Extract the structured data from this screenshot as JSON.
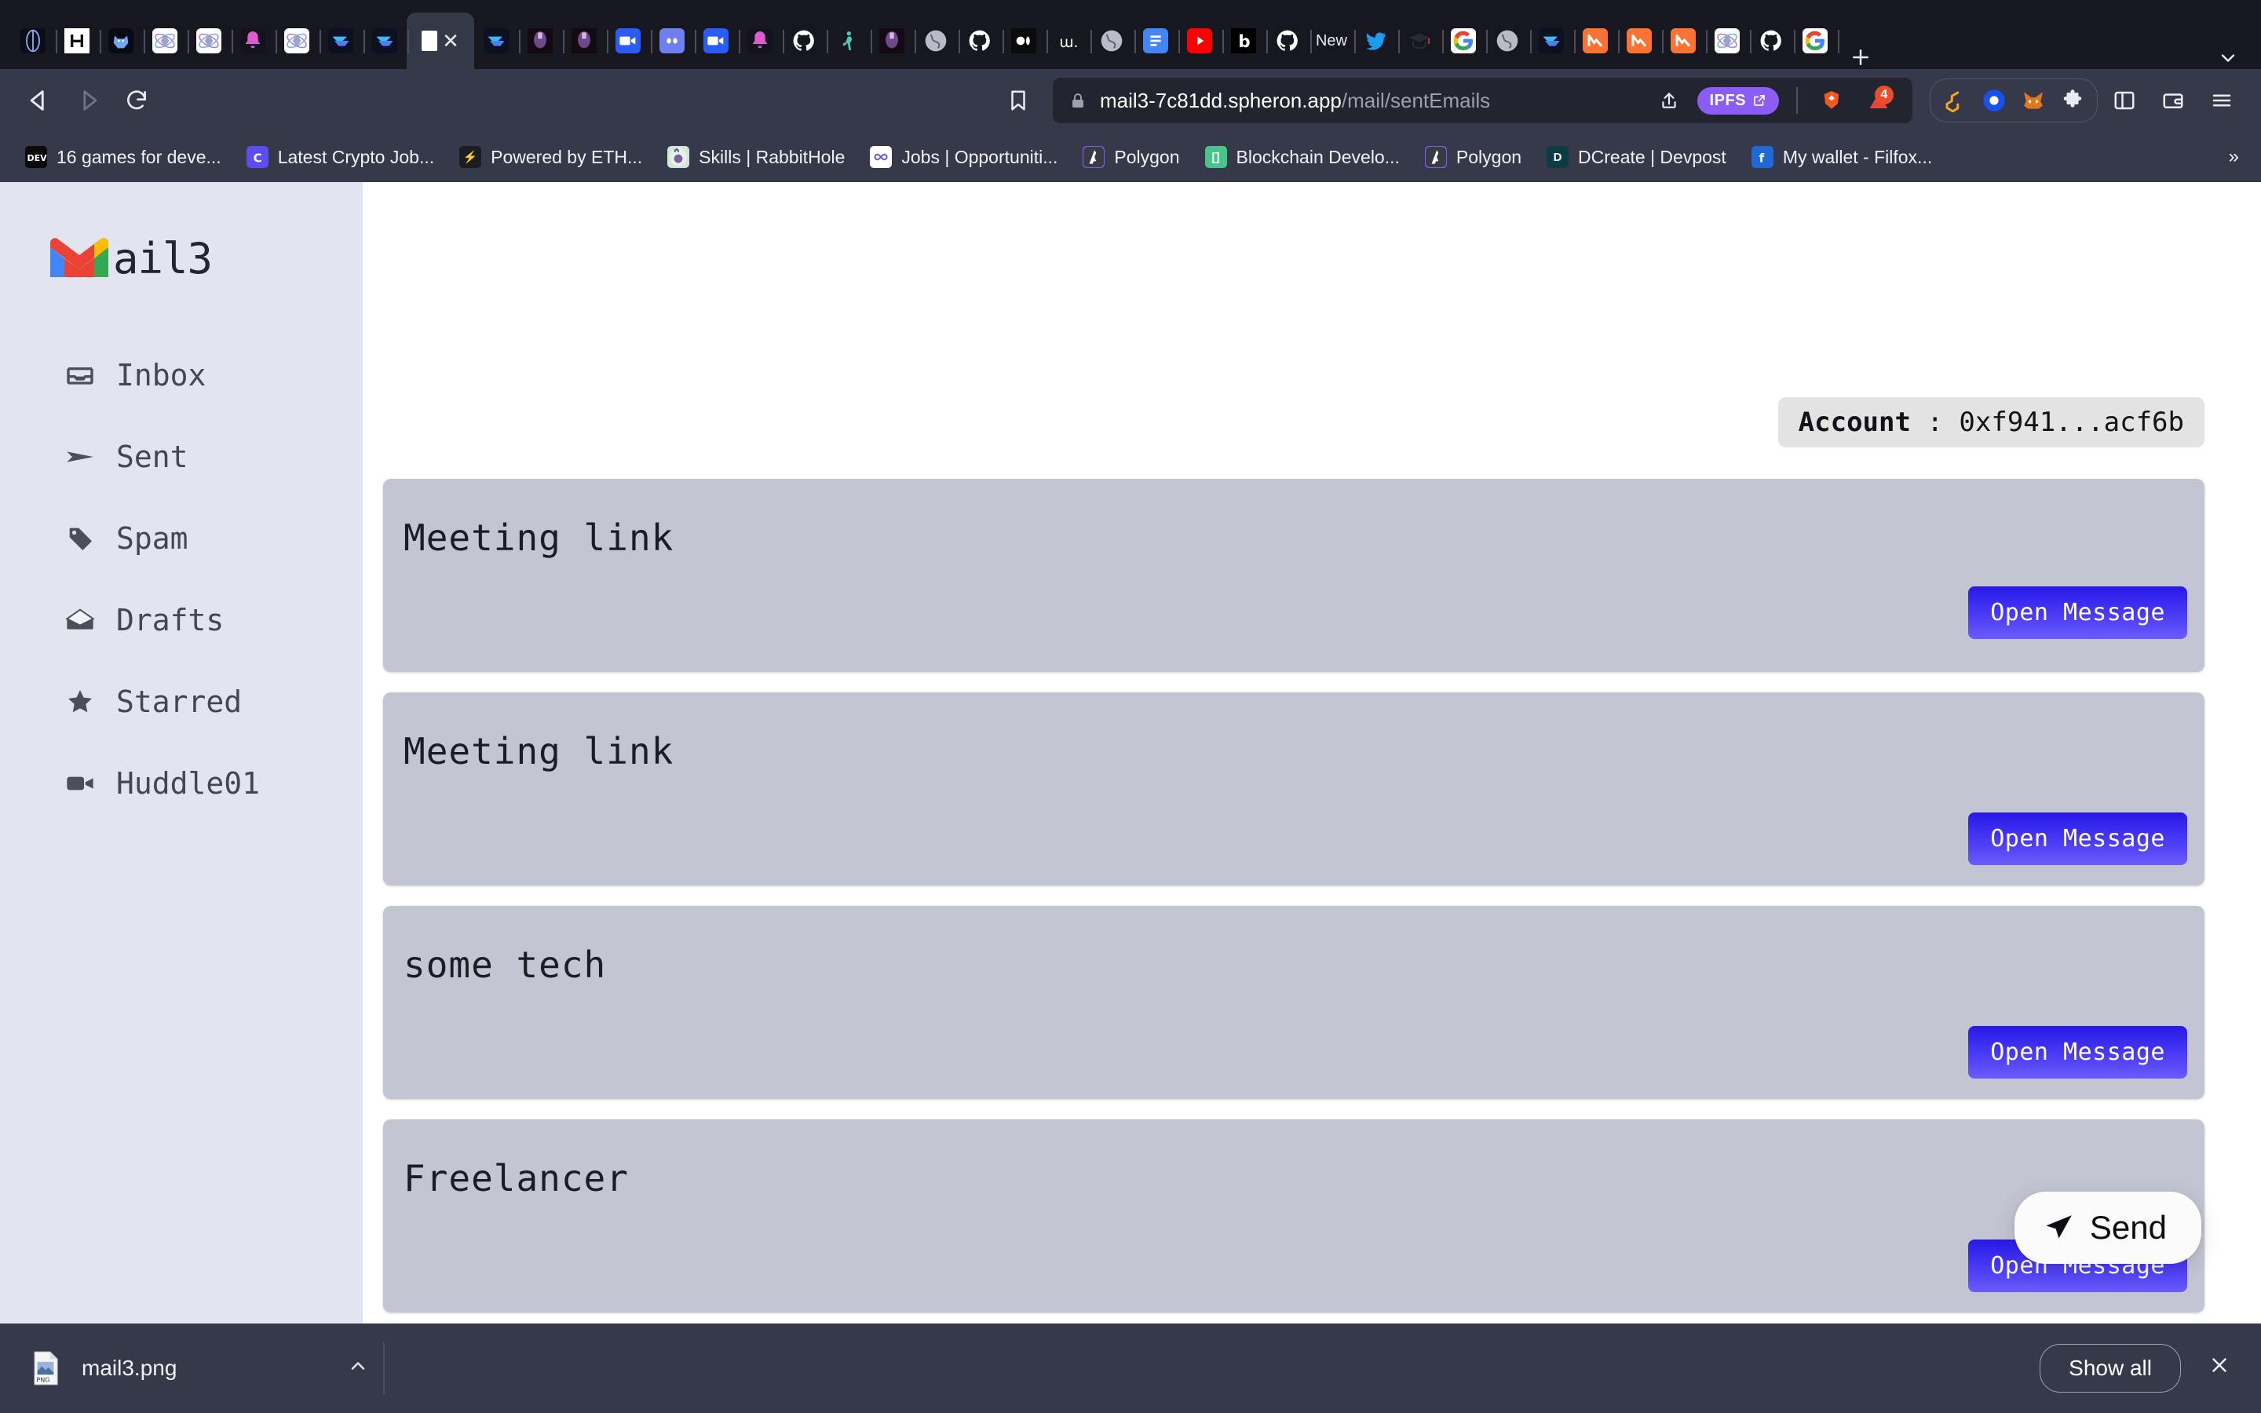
{
  "browser": {
    "tabs": [
      {
        "name": "tab-ethereum",
        "icon": "ethereum-outline-icon",
        "color": "#0b0d17"
      },
      {
        "name": "tab-indie-hackers",
        "icon": "indiehackers-icon",
        "color": "#ffffff"
      },
      {
        "name": "tab-metamask-fox",
        "icon": "fox-icon",
        "color": "#0a0a12"
      },
      {
        "name": "tab-ethereum-atom-1",
        "icon": "atom-icon",
        "color": "#ffffff"
      },
      {
        "name": "tab-ethereum-atom-2",
        "icon": "atom-icon",
        "color": "#ffffff"
      },
      {
        "name": "tab-notification-bell",
        "icon": "bell-icon",
        "color": "#12131c"
      },
      {
        "name": "tab-ethereum-atom-3",
        "icon": "atom-icon",
        "color": "#ffffff"
      },
      {
        "name": "tab-spheron-1",
        "icon": "spheron-icon",
        "color": "#0d1020"
      },
      {
        "name": "tab-spheron-2",
        "icon": "spheron-icon",
        "color": "#0d1020"
      },
      {
        "name": "tab-mail3-active",
        "icon": "mail3-icon",
        "color": "#343948",
        "active": true
      },
      {
        "name": "tab-spheron-3",
        "icon": "spheron-icon",
        "color": "#0d1020"
      },
      {
        "name": "tab-nft-avatar-1",
        "icon": "avatar-icon",
        "color": "#140a14"
      },
      {
        "name": "tab-nft-avatar-2",
        "icon": "avatar-icon",
        "color": "#140a14"
      },
      {
        "name": "tab-huddle01-1",
        "icon": "huddle01-icon",
        "color": "#2b5cf6"
      },
      {
        "name": "tab-discord",
        "icon": "discord-icon",
        "color": "#6f7ff0"
      },
      {
        "name": "tab-huddle01-2",
        "icon": "huddle01-icon",
        "color": "#2b5cf6"
      },
      {
        "name": "tab-bell-2",
        "icon": "bell-icon",
        "color": "#12131c"
      },
      {
        "name": "tab-github-1",
        "icon": "github-icon",
        "color": "#16171f"
      },
      {
        "name": "tab-runner",
        "icon": "runner-icon",
        "color": "#16171f"
      },
      {
        "name": "tab-nft-avatar-3",
        "icon": "avatar-icon",
        "color": "#140a14"
      },
      {
        "name": "tab-globe-1",
        "icon": "globe-icon",
        "color": "#16171f"
      },
      {
        "name": "tab-github-2",
        "icon": "github-icon",
        "color": "#16171f"
      },
      {
        "name": "tab-medium",
        "icon": "medium-icon",
        "color": "#0b0b0b"
      },
      {
        "name": "tab-lu-app",
        "icon": "lu-icon",
        "color": "#16171f"
      },
      {
        "name": "tab-globe-2",
        "icon": "globe-icon",
        "color": "#16171f"
      },
      {
        "name": "tab-google-docs",
        "icon": "docs-icon",
        "color": "#4285f4"
      },
      {
        "name": "tab-youtube",
        "icon": "youtube-icon",
        "color": "#ff0000"
      },
      {
        "name": "tab-b-app",
        "icon": "b-icon",
        "color": "#000000"
      },
      {
        "name": "tab-github-3",
        "icon": "github-icon",
        "color": "#16171f"
      },
      {
        "name": "tab-new",
        "icon": "new-text-icon",
        "color": "#16171f",
        "text": "New"
      },
      {
        "name": "tab-twitter",
        "icon": "twitter-icon",
        "color": "#16171f"
      },
      {
        "name": "tab-graduation",
        "icon": "graduation-cap-icon",
        "color": "#16171f"
      },
      {
        "name": "tab-google-1",
        "icon": "google-icon",
        "color": "#ffffff"
      },
      {
        "name": "tab-globe-3",
        "icon": "globe-icon",
        "color": "#16171f"
      },
      {
        "name": "tab-spheron-4",
        "icon": "spheron-icon",
        "color": "#0d1020"
      },
      {
        "name": "tab-netlify-1",
        "icon": "netlify-n-icon",
        "color": "#f97432"
      },
      {
        "name": "tab-netlify-2",
        "icon": "netlify-n-icon",
        "color": "#f97432"
      },
      {
        "name": "tab-netlify-3",
        "icon": "netlify-n-icon",
        "color": "#f97432"
      },
      {
        "name": "tab-ethereum-atom-4",
        "icon": "atom-icon",
        "color": "#ffffff"
      },
      {
        "name": "tab-github-4",
        "icon": "github-icon",
        "color": "#16171f"
      },
      {
        "name": "tab-google-2",
        "icon": "google-icon",
        "color": "#ffffff"
      }
    ],
    "new_tab_label": "+",
    "tab_list_chevron": "chevron-down-icon",
    "url": {
      "domain": "mail3-7c81dd.spheron.app",
      "path": "/mail/sentEmails",
      "lock_icon": "lock-icon"
    },
    "ipfs_badge": "IPFS",
    "shield_badge_count": "4",
    "bookmarks": [
      {
        "label": "16 games for deve...",
        "icon": "dev-icon",
        "color": "#0b0b0b",
        "glyph": "DEV"
      },
      {
        "label": "Latest Crypto Job...",
        "icon": "cryptojobs-icon",
        "color": "#5b4df0",
        "glyph": "C"
      },
      {
        "label": "Powered by ETH...",
        "icon": "lightning-icon",
        "color": "#1b1c24",
        "glyph": "⚡"
      },
      {
        "label": "Skills | RabbitHole",
        "icon": "rabbithole-icon",
        "color": "#cfe6d8",
        "glyph": ""
      },
      {
        "label": "Jobs | Opportuniti...",
        "icon": "opportunities-icon",
        "color": "#ffffff",
        "glyph": ""
      },
      {
        "label": "Polygon",
        "icon": "polygon-icon",
        "color": "#7b5cf0",
        "glyph": ""
      },
      {
        "label": "Blockchain Develo...",
        "icon": "blockchain-icon",
        "color": "#4ac48a",
        "glyph": "[]"
      },
      {
        "label": "Polygon",
        "icon": "polygon-icon",
        "color": "#7b5cf0",
        "glyph": ""
      },
      {
        "label": "DCreate | Devpost",
        "icon": "devpost-icon",
        "color": "#0d3b45",
        "glyph": "D"
      },
      {
        "label": "My wallet - Filfox...",
        "icon": "filfox-icon",
        "color": "#1f68d6",
        "glyph": "f"
      }
    ],
    "bookmarks_overflow": "»",
    "toolbar_icons": {
      "back": "back-arrow-icon",
      "forward": "forward-arrow-icon",
      "reload": "reload-icon",
      "bookmark": "bookmark-icon",
      "share": "share-icon",
      "brave_shields": "brave-lion-icon",
      "brave_rewards": "brave-triangle-icon",
      "extension_gitpod": "gitpod-icon",
      "extension_wallet": "wallet-dot-icon",
      "extension_metamask": "metamask-fox-icon",
      "extensions_puzzle": "puzzle-icon",
      "sidebar_toggle": "sidebar-panel-icon",
      "wallet_panel": "wallet-icon",
      "menu": "hamburger-menu-icon"
    }
  },
  "app": {
    "logo_text": "ail3",
    "logo_icon": "gmail-m-icon",
    "sidebar": {
      "items": [
        {
          "label": "Inbox",
          "icon": "inbox-tray-icon"
        },
        {
          "label": "Sent",
          "icon": "send-arrow-icon"
        },
        {
          "label": "Spam",
          "icon": "tag-icon"
        },
        {
          "label": "Drafts",
          "icon": "open-envelope-icon"
        },
        {
          "label": "Starred",
          "icon": "star-icon"
        },
        {
          "label": "Huddle01",
          "icon": "video-camera-icon"
        }
      ]
    },
    "account": {
      "label": "Account",
      "separator": ":",
      "address": "0xf941...acf6b"
    },
    "emails": [
      {
        "subject": "Meeting link",
        "button": "Open Message"
      },
      {
        "subject": "Meeting link",
        "button": "Open Message"
      },
      {
        "subject": "some tech",
        "button": "Open Message"
      },
      {
        "subject": "Freelancer",
        "button": "Open Message"
      }
    ],
    "send_button": {
      "label": "Send",
      "icon": "paper-plane-icon"
    }
  },
  "downloads": {
    "file_name": "mail3.png",
    "file_icon": "png-file-icon",
    "expand_icon": "chevron-up-icon",
    "show_all_label": "Show all",
    "close_icon": "close-icon"
  },
  "colors": {
    "chrome": "#35394a",
    "tabstrip": "#16171f",
    "sidebar": "#e2e4ef",
    "card": "#c3c5d2",
    "button_gradient_start": "#2618e8",
    "button_gradient_end": "#6a5cfa",
    "ipfs": "#8b5cf6"
  }
}
